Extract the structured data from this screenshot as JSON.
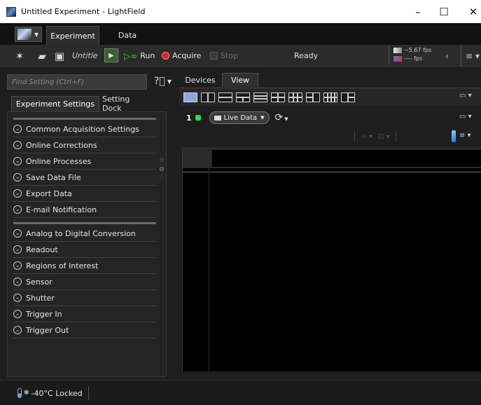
{
  "window": {
    "title": "Untitled Experiment - LightField",
    "controls": {
      "minimize": "–",
      "maximize": "☐",
      "close": "✕"
    }
  },
  "ribbon": {
    "tabs": [
      {
        "label": "Experiment"
      },
      {
        "label": "Data"
      }
    ]
  },
  "toolbar": {
    "experiment_name": "Untitle",
    "run_label": "Run",
    "acquire_label": "Acquire",
    "stop_label": "Stop",
    "status": "Ready",
    "fps_top": "~5.67 fps",
    "fps_bottom": "---- fps"
  },
  "left_panel": {
    "find_placeholder": "Find Setting (Ctrl+F)",
    "tabs": [
      {
        "label": "Experiment Settings"
      },
      {
        "label": "Setting Dock"
      }
    ],
    "group1": [
      "Common Acquisition Settings",
      "Online Corrections",
      "Online Processes",
      "Save Data File",
      "Export Data",
      "E-mail Notification"
    ],
    "group2": [
      "Analog to Digital Conversion",
      "Readout",
      "Regions of Interest",
      "Sensor",
      "Shutter",
      "Trigger In",
      "Trigger Out"
    ]
  },
  "right_panel": {
    "tabs": [
      {
        "label": "Devices"
      },
      {
        "label": "View"
      }
    ],
    "view_number": "1",
    "live_data_label": "Live Data"
  },
  "status_bar": {
    "temperature": "-40°C Locked"
  },
  "icons": {
    "new": "wand-icon",
    "open": "folder-icon",
    "save": "floppy-icon"
  },
  "colors": {
    "accent_green": "#2fdc3a",
    "acquire_red": "#e02020",
    "layout_selected": "#8aa8d8"
  }
}
